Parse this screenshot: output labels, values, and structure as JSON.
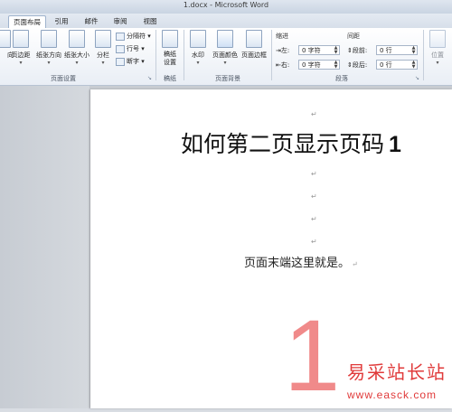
{
  "window": {
    "title": "1.docx - Microsoft Word"
  },
  "tabs": [
    {
      "label": "页面布局",
      "active": true
    },
    {
      "label": "引用",
      "active": false
    },
    {
      "label": "邮件",
      "active": false
    },
    {
      "label": "审阅",
      "active": false
    },
    {
      "label": "视图",
      "active": false
    }
  ],
  "ribbon": {
    "page_setup": {
      "label": "页面设置",
      "direction_tail": "向",
      "margins": "页边距",
      "orientation": "纸张方向",
      "size": "纸张大小",
      "columns": "分栏",
      "breaks": "分隔符",
      "line_numbers": "行号",
      "hyphenation": "断字"
    },
    "manuscript": {
      "label": "稿纸",
      "button": "稿纸设置"
    },
    "page_background": {
      "label": "页面背景",
      "watermark": "水印",
      "page_color": "页面颜色",
      "page_borders": "页面边框"
    },
    "paragraph": {
      "label": "段落",
      "indent_title": "缩进",
      "spacing_title": "间距",
      "indent_left_label": "左:",
      "indent_left_value": "0 字符",
      "indent_right_label": "右:",
      "indent_right_value": "0 字符",
      "spacing_before_label": "段前:",
      "spacing_before_value": "0 行",
      "spacing_after_label": "段后:",
      "spacing_after_value": "0 行"
    },
    "arrange": {
      "position": "位置"
    }
  },
  "document": {
    "heading": "如何第二页显示页码",
    "heading_number": "1",
    "paragraph_mark": "↵",
    "body_text": "页面末端这里就是。",
    "page_number": "1"
  },
  "watermark": {
    "line1": "易采站长站",
    "line2": "www.easck.com"
  },
  "colors": {
    "page_number": "#f08a8a",
    "watermark": "#e03a3a",
    "ribbon_border": "#b7c3d3"
  }
}
